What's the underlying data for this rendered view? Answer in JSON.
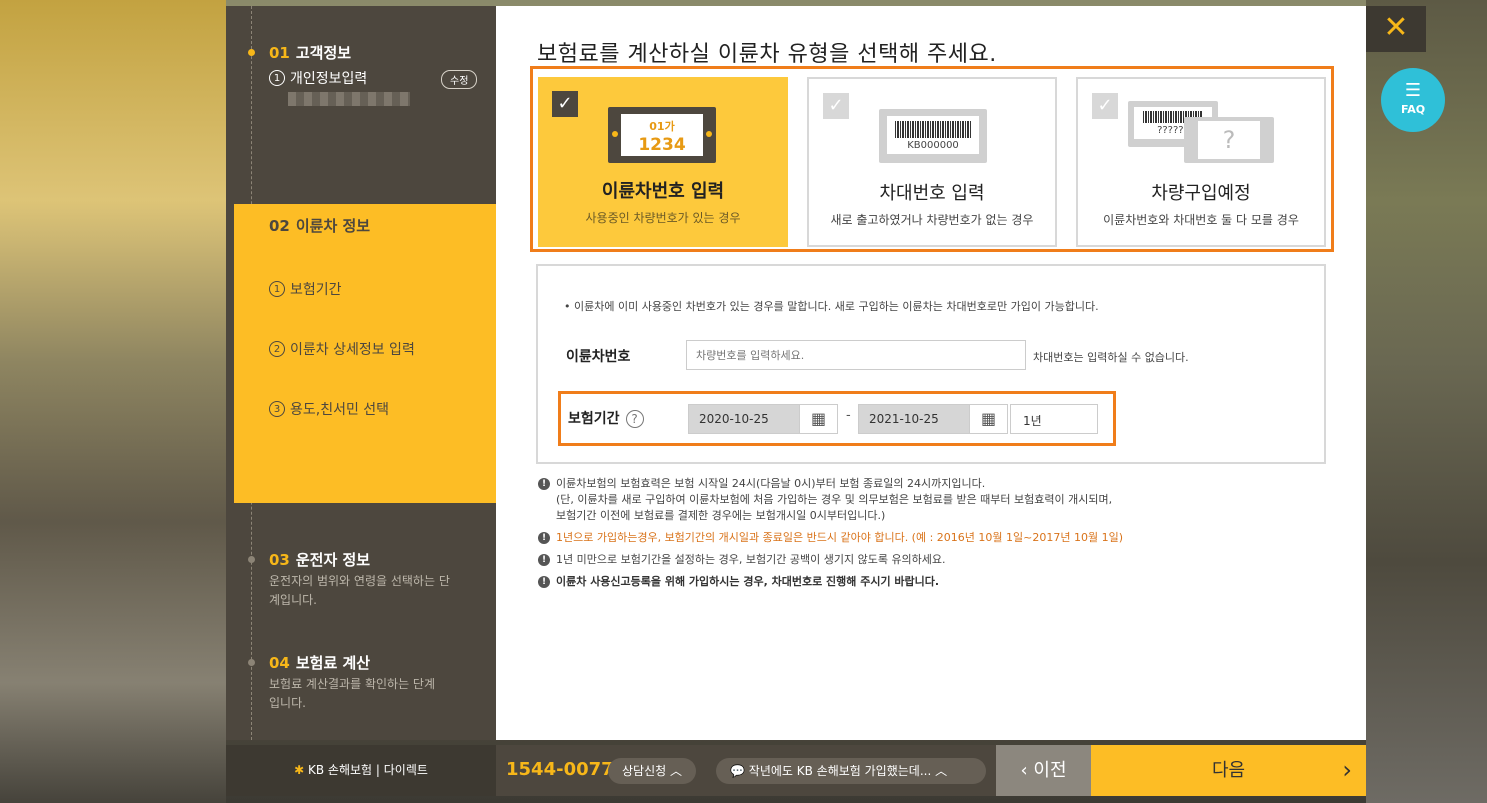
{
  "sidebar": {
    "step1": {
      "num": "01",
      "title": "고객정보",
      "sub1": "개인정보입력",
      "sub1_num": "1",
      "edit": "수정"
    },
    "step2": {
      "num": "02",
      "title": "이륜차 정보",
      "items": [
        {
          "num": "1",
          "label": "보험기간"
        },
        {
          "num": "2",
          "label": "이륜차 상세정보 입력"
        },
        {
          "num": "3",
          "label": "용도,친서민 선택"
        }
      ]
    },
    "step3": {
      "num": "03",
      "title": "운전자 정보",
      "desc": "운전자의 범위와 연령을 선택하는 단계입니다."
    },
    "step4": {
      "num": "04",
      "title": "보험료 계산",
      "desc": "보험료 계산결과를 확인하는 단계입니다."
    }
  },
  "main": {
    "heading": "보험료를 계산하실 이륜차 유형을 선택해 주세요.",
    "cards": [
      {
        "title": "이륜차번호 입력",
        "desc": "사용중인 차량번호가 있는 경우",
        "plate_top": "01가",
        "plate_num": "1234"
      },
      {
        "title": "차대번호 입력",
        "desc": "새로 출고하였거나 차량번호가 없는 경우",
        "barcode": "KB000000"
      },
      {
        "title": "차량구입예정",
        "desc": "이륜차번호와 차대번호 둘 다 모를 경우",
        "barcode": "??????",
        "unknown": "?"
      }
    ],
    "info_note": "• 이륜차에 이미 사용중인 차번호가 있는 경우를 말합니다. 새로 구입하는 이륜차는 차대번호로만 가입이 가능합니다.",
    "plate_label": "이륜차번호",
    "plate_placeholder": "차량번호를 입력하세요.",
    "plate_hint": "차대번호는 입력하실 수 없습니다.",
    "period_label": "보험기간",
    "help": "?",
    "start_date": "2020-10-25",
    "end_date": "2021-10-25",
    "dash": "-",
    "years": "1년",
    "notes": [
      "이륜차보험의 보험효력은 보험 시작일 24시(다음날 0시)부터 보험 종료일의 24시까지입니다.",
      "(단, 이륜차를 새로 구입하여 이륜차보험에 처음 가입하는 경우 및 의무보험은 보험료를 받은 때부터 보험효력이 개시되며,",
      "보험기간 이전에 보험료를 결제한 경우에는 보험개시일 0시부터입니다.)",
      "1년으로 가입하는경우, 보험기간의 개시일과 종료일은 반드시 같아야 합니다. (예 : 2016년 10월 1일~2017년 10월 1일)",
      "1년 미만으로 보험기간을 설정하는 경우, 보험기간 공백이 생기지 않도록 유의하세요.",
      "이륜차 사용신고등록을 위해 가입하시는 경우, 차대번호로 진행해 주시기 바랍니다."
    ]
  },
  "bottom": {
    "logo": "KB 손해보험 | 다이렉트",
    "phone": "1544-0077",
    "consult": "상담신청",
    "chat": "작년에도 KB 손해보험 가입했는데...",
    "prev": "이전",
    "next": "다음"
  },
  "close": "✕",
  "faq": "FAQ",
  "colors": {
    "accent": "#fdbd25",
    "highlight": "#f07d1a",
    "dark": "#4d473e",
    "faq": "#2fc0d8"
  }
}
